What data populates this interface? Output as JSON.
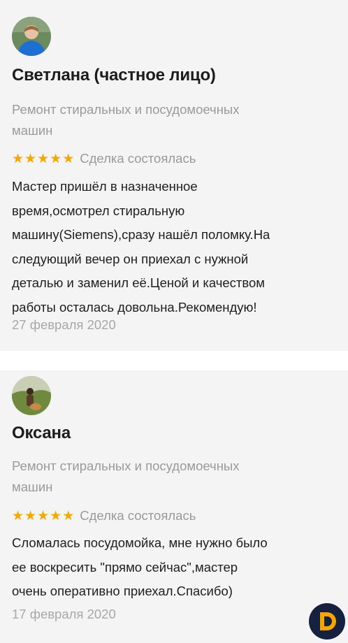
{
  "reviews": [
    {
      "name": "Светлана (частное лицо)",
      "category_lines": [
        "Ремонт стиральных и посудомоечных",
        "машин"
      ],
      "rating": 5,
      "deal_status": "Сделка состоялась",
      "text_lines": [
        "Мастер пришёл в назначенное",
        "время,осмотрел стиральную",
        "машину(Siemens),сразу нашёл поломку.На",
        "следующий вечер он приехал с нужной",
        "деталью и заменил её.Ценой и качеством",
        "работы осталась довольна.Рекомендую!"
      ],
      "date": "27 февраля 2020"
    },
    {
      "name": "Оксана",
      "category_lines": [
        "Ремонт стиральных и посудомоечных",
        "машин"
      ],
      "rating": 5,
      "deal_status": "Сделка состоялась",
      "text_lines": [
        "Сломалась посудомойка, мне нужно было",
        "ее воскресить \"прямо сейчас\",мастер",
        "очень оперативно приехал.Спасибо)"
      ],
      "date": "17 февраля 2020"
    }
  ],
  "icons": {
    "star": "star-icon",
    "logo": "logo-icon"
  },
  "colors": {
    "star": "#f5a800",
    "logo_orange": "#f7a600",
    "logo_navy": "#16213f"
  }
}
